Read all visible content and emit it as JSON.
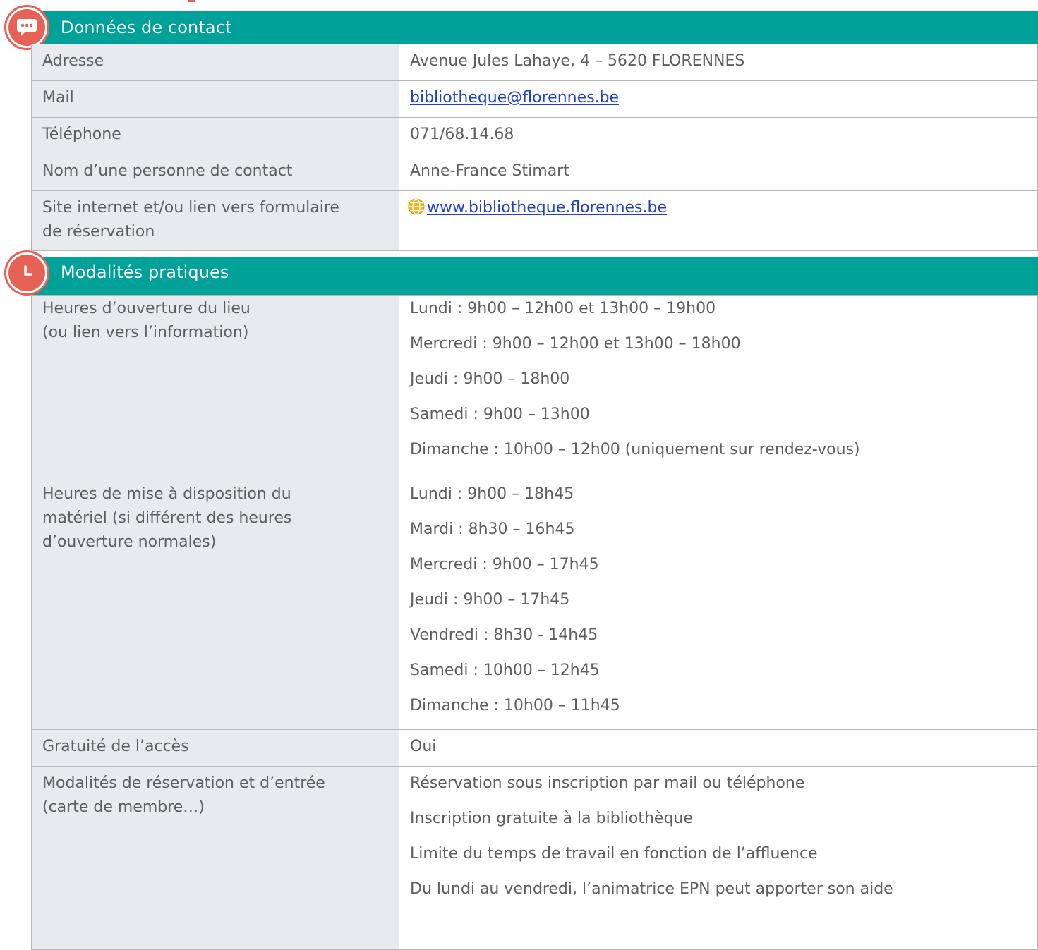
{
  "sections": [
    {
      "title": "Données de contact",
      "icon": "speech-bubble-icon",
      "rows": [
        {
          "label": [
            "Adresse"
          ],
          "value": [
            "Avenue Jules Lahaye, 4 – 5620 FLORENNES"
          ]
        },
        {
          "label": [
            "Mail"
          ],
          "value": [
            "bibliotheque@florennes.be"
          ],
          "link": true
        },
        {
          "label": [
            "Téléphone"
          ],
          "value": [
            "071/68.14.68"
          ]
        },
        {
          "label": [
            "Nom d’une personne de contact"
          ],
          "value": [
            "Anne-France Stimart"
          ]
        },
        {
          "label": [
            "Site internet et/ou lien vers formulaire",
            "de réservation"
          ],
          "value": [
            "www.bibliotheque.florennes.be"
          ],
          "link": true,
          "globe": true
        }
      ]
    },
    {
      "title": "Modalités pratiques",
      "icon": "clock-icon",
      "rows": [
        {
          "label": [
            "Heures d’ouverture du lieu",
            "(ou lien vers l’information)"
          ],
          "value": [
            "Lundi : 9h00 – 12h00 et 13h00 – 19h00",
            "Mercredi : 9h00 – 12h00 et 13h00 – 18h00",
            "Jeudi : 9h00 – 18h00",
            "Samedi : 9h00 – 13h00",
            "Dimanche : 10h00 – 12h00 (uniquement sur rendez-vous)"
          ]
        },
        {
          "label": [
            "Heures de mise à disposition du",
            "matériel (si différent des heures",
            "d’ouverture normales)"
          ],
          "value": [
            "Lundi : 9h00 – 18h45",
            "Mardi : 8h30 – 16h45",
            "Mercredi : 9h00 – 17h45",
            "Jeudi : 9h00 – 17h45",
            "Vendredi : 8h30 - 14h45",
            "Samedi : 10h00 – 12h45",
            "Dimanche : 10h00 – 11h45"
          ]
        },
        {
          "label": [
            "Gratuité de l’accès"
          ],
          "value": [
            "Oui"
          ]
        },
        {
          "label": [
            "Modalités de réservation et d’entrée",
            "(carte de membre…)"
          ],
          "value": [
            "Réservation sous inscription par mail ou téléphone",
            "Inscription gratuite à la bibliothèque",
            "Limite du temps de travail en fonction de l’affluence",
            "Du lundi au vendredi, l’animatrice EPN peut apporter son aide"
          ]
        }
      ]
    }
  ],
  "colors": {
    "header_bg": "#00a199",
    "icon_accent": "#e66156",
    "label_bg": "#e8ebee",
    "link": "#1f3fd0"
  }
}
